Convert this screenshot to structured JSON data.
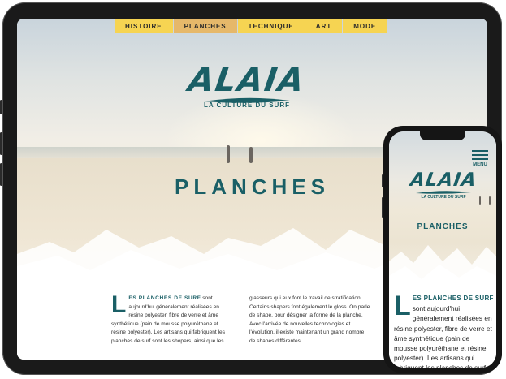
{
  "nav": {
    "items": [
      {
        "label": "HISTOIRE",
        "active": false
      },
      {
        "label": "PLANCHES",
        "active": true
      },
      {
        "label": "TECHNIQUE",
        "active": false
      },
      {
        "label": "ART",
        "active": false
      },
      {
        "label": "MODE",
        "active": false
      }
    ]
  },
  "brand": {
    "name": "ALAIA",
    "tagline": "LA CULTURE DU SURF"
  },
  "hero": {
    "title": "PLANCHES"
  },
  "article": {
    "dropcap": "L",
    "lead": "ES PLANCHES DE SURF",
    "col1_rest": " sont aujourd'hui généralement réalisées en résine polyester, fibre de verre et âme synthétique (pain de mousse polyuréthane et résine polyester). Les artisans qui fabriquent les planches de surf sont les shopers, ainsi que les",
    "col2": "glasseurs qui eux font le travail de stratification. Certains shapers font également le gloss. On parle de shape, pour désigner la forme de la planche. Avec l'arrivée de nouvelles technologies et l'évolution, il existe maintenant un grand nombre de shapes différentes."
  },
  "mobile": {
    "menu_label": "MENU",
    "text_rest": " sont aujourd'hui généralement réalisées en résine polyester, fibre de verre et âme synthétique (pain de mousse polyuréthane et résine polyester). Les artisans qui fabriquent les planches de surf sont les shapers,"
  },
  "colors": {
    "accent": "#1a5f66",
    "nav_bg": "#f6d452",
    "nav_active": "#e6b86a"
  }
}
